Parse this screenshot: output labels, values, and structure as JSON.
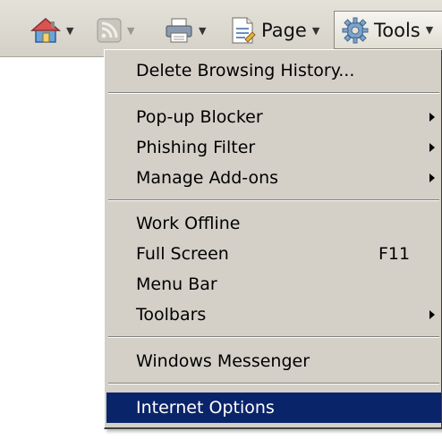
{
  "toolbar": {
    "page_label": "Page",
    "tools_label": "Tools",
    "icons": [
      "home-icon",
      "feeds-icon",
      "print-icon",
      "page-icon",
      "gear-icon"
    ]
  },
  "menu": {
    "items": [
      {
        "label": "Delete Browsing History..."
      },
      {
        "label": "Pop-up Blocker"
      },
      {
        "label": "Phishing Filter"
      },
      {
        "label": "Manage Add-ons"
      },
      {
        "label": "Work Offline"
      },
      {
        "label": "Full Screen",
        "shortcut": "F11"
      },
      {
        "label": "Menu Bar"
      },
      {
        "label": "Toolbars"
      },
      {
        "label": "Windows Messenger"
      },
      {
        "label": "Internet Options"
      }
    ]
  },
  "colors": {
    "menu_background": "#d4d0c8",
    "selection_background": "#0a246a",
    "selection_text": "#ffffff"
  }
}
